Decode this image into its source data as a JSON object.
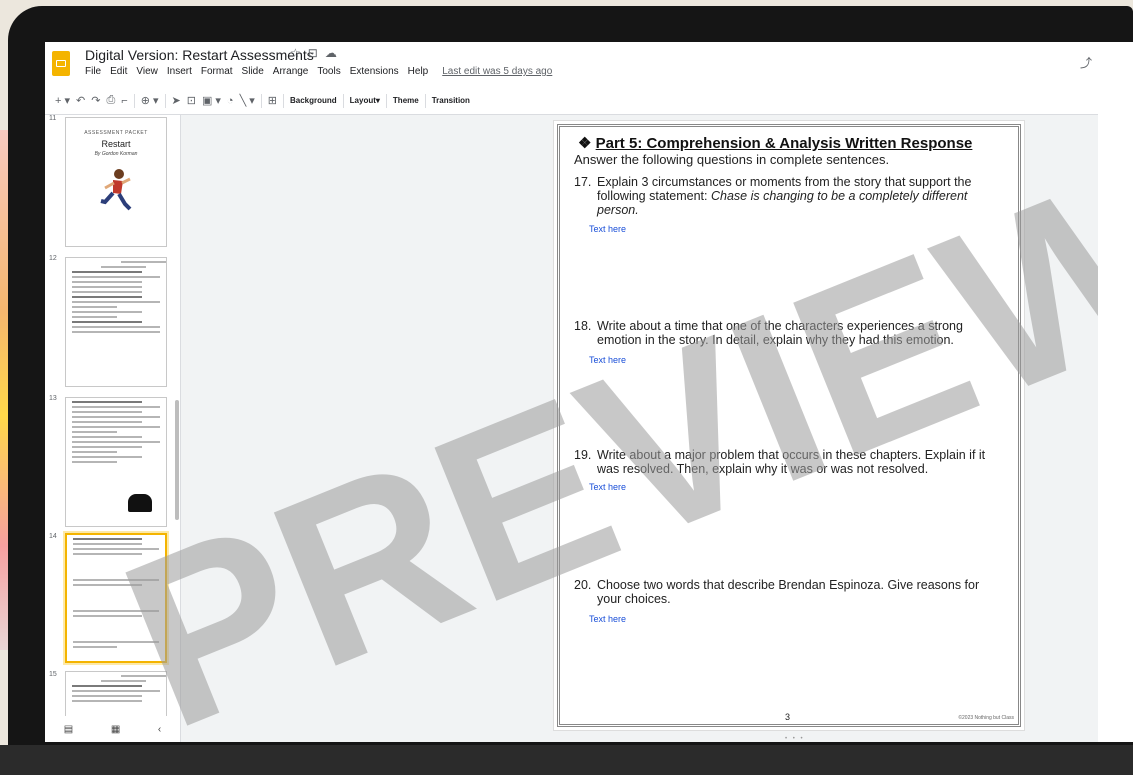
{
  "app": {
    "doc_title": "Digital Version: Restart Assessments",
    "title_icons": [
      "star-icon",
      "folder-icon",
      "cloud-icon"
    ],
    "menu": [
      "File",
      "Edit",
      "View",
      "Insert",
      "Format",
      "Slide",
      "Arrange",
      "Tools",
      "Extensions",
      "Help"
    ],
    "last_edit": "Last edit was 5 days ago"
  },
  "toolbar": {
    "background": "Background",
    "layout": "Layout",
    "theme": "Theme",
    "transition": "Transition"
  },
  "filmstrip": {
    "slides": [
      {
        "num": "11",
        "title_small": "ASSESSMENT PACKET",
        "title": "Restart",
        "author": "By Gordon Korman"
      },
      {
        "num": "12"
      },
      {
        "num": "13"
      },
      {
        "num": "14",
        "selected": true
      },
      {
        "num": "15"
      }
    ]
  },
  "slide": {
    "heading": "Part 5: Comprehension & Analysis Written Response",
    "instructions": "Answer the following questions in complete sentences.",
    "questions": [
      {
        "num": "17.",
        "text": "Explain 3 circumstances or moments from the story that support the following statement:",
        "quote": "Chase is changing to be a completely different person.",
        "answer": "Text here"
      },
      {
        "num": "18.",
        "text": "Write about a time that one of the characters experiences a strong emotion in the story. In detail, explain why they had this emotion.",
        "answer": "Text here"
      },
      {
        "num": "19.",
        "text": "Write about a major problem that occurs in these chapters. Explain if it was resolved. Then, explain why it was or was not resolved.",
        "answer": "Text here"
      },
      {
        "num": "20.",
        "text": "Choose two words that describe Brendan Espinoza. Give reasons for your choices.",
        "answer": "Text here"
      }
    ],
    "page_number": "3",
    "copyright": "©2023 Nothing but Class"
  },
  "watermark": "PREVIEW ONLY",
  "colors": {
    "accent": "#f4b400",
    "link": "#1a4fd8"
  }
}
